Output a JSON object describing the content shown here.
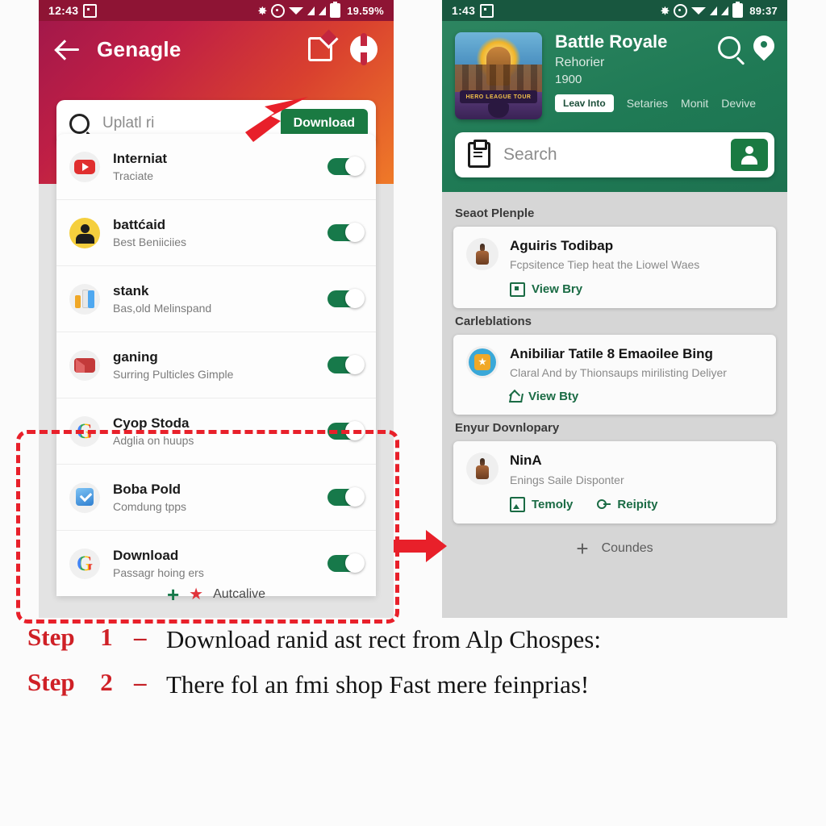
{
  "left_phone": {
    "statusbar": {
      "time": "12:43",
      "battery_text": "19.59%",
      "icons": [
        "bluetooth-icon",
        "alarm-icon",
        "wifi-icon",
        "signal-icon",
        "signal-icon",
        "battery-icon"
      ]
    },
    "header": {
      "title": "Genagle",
      "back_icon": "back-arrow-icon",
      "share_icon": "share-icon",
      "help_icon": "help-icon"
    },
    "search": {
      "value": "Uplatl ri",
      "icon": "search-icon",
      "download_label": "Download"
    },
    "apps": [
      {
        "title": "Interniat",
        "subtitle": "Traciate",
        "icon": "youtube-icon",
        "toggle": "on"
      },
      {
        "title": "battćaid",
        "subtitle": "Best Beniiciies",
        "icon": "contacts-icon",
        "toggle": "on"
      },
      {
        "title": "stank",
        "subtitle": "Bas,old Melinspand",
        "icon": "books-icon",
        "toggle": "on"
      },
      {
        "title": "ganing",
        "subtitle": "Surring Pulticles Gimple",
        "icon": "mail-icon",
        "toggle": "on"
      },
      {
        "title": "Cyop Stoda",
        "subtitle": "Adglia on huups",
        "icon": "google-icon",
        "toggle": "on"
      },
      {
        "title": "Boba Pold",
        "subtitle": "Comdung tpps",
        "icon": "blue-check-icon",
        "toggle": "on"
      },
      {
        "title": "Download",
        "subtitle": "Passagr hoing ers",
        "icon": "google-icon",
        "toggle": "on"
      }
    ],
    "footer": {
      "plus_icon": "plus-icon",
      "star_icon": "star-icon",
      "label": "Autcalive"
    }
  },
  "right_phone": {
    "statusbar": {
      "time": "1:43",
      "battery_text": "89:37",
      "icons": [
        "bluetooth-icon",
        "alarm-icon",
        "wifi-icon",
        "signal-icon",
        "signal-icon",
        "battery-icon"
      ]
    },
    "header": {
      "game_title": "Battle Royale",
      "subtitle": "Rehorier",
      "number": "1900",
      "thumb_caption": "HERO LEAGUE TOUR",
      "search_icon": "search-icon",
      "pin_icon": "location-pin-icon",
      "tabs": [
        {
          "label": "Leav Into",
          "active": true
        },
        {
          "label": "Setaries",
          "active": false
        },
        {
          "label": "Monit",
          "active": false
        },
        {
          "label": "Devive",
          "active": false
        }
      ]
    },
    "search": {
      "placeholder": "Search",
      "clipboard_icon": "clipboard-icon",
      "person_icon": "person-icon"
    },
    "sections": [
      {
        "label": "Seaot Plenple",
        "card": {
          "icon": "chess-piece-icon",
          "title": "Aguiris Todibap",
          "subtitle": "Fcpsitence Tiep heat the Liowel Waes",
          "links": [
            {
              "label": "View Bry",
              "icon": "frame-icon"
            }
          ]
        }
      },
      {
        "label": "Carleblations",
        "card": {
          "icon": "medal-icon",
          "title": "Anibiliar Tatile 8 Emaoilee Bing",
          "subtitle": "Claral And by Thionsaups mirilisting Deliyer",
          "links": [
            {
              "label": "View Bty",
              "icon": "share-outline-icon"
            }
          ]
        }
      },
      {
        "label": "Enyur Dovnlopary",
        "card": {
          "icon": "chess-piece-icon",
          "title": "NinA",
          "subtitle": "Enings Saile Disponter",
          "links": [
            {
              "label": "Temoly",
              "icon": "image-icon"
            },
            {
              "label": "Reipity",
              "icon": "key-icon"
            }
          ]
        }
      }
    ],
    "footer": {
      "plus_icon": "plus-icon",
      "label": "Coundes"
    }
  },
  "steps": [
    {
      "label": "Step",
      "number": "1",
      "dash": "–",
      "text": "Download ranid ast rect from Alp Chospes:"
    },
    {
      "label": "Step",
      "number": "2",
      "dash": "–",
      "text": "There fol an fmi shop Fast mere feinprias!"
    }
  ],
  "colors": {
    "left_header_start": "#a3184a",
    "left_header_end": "#ef7a28",
    "right_header": "#1f7a55",
    "accent_green": "#1a7a42",
    "annotation_red": "#e8202a",
    "step_red": "#cf2026"
  }
}
